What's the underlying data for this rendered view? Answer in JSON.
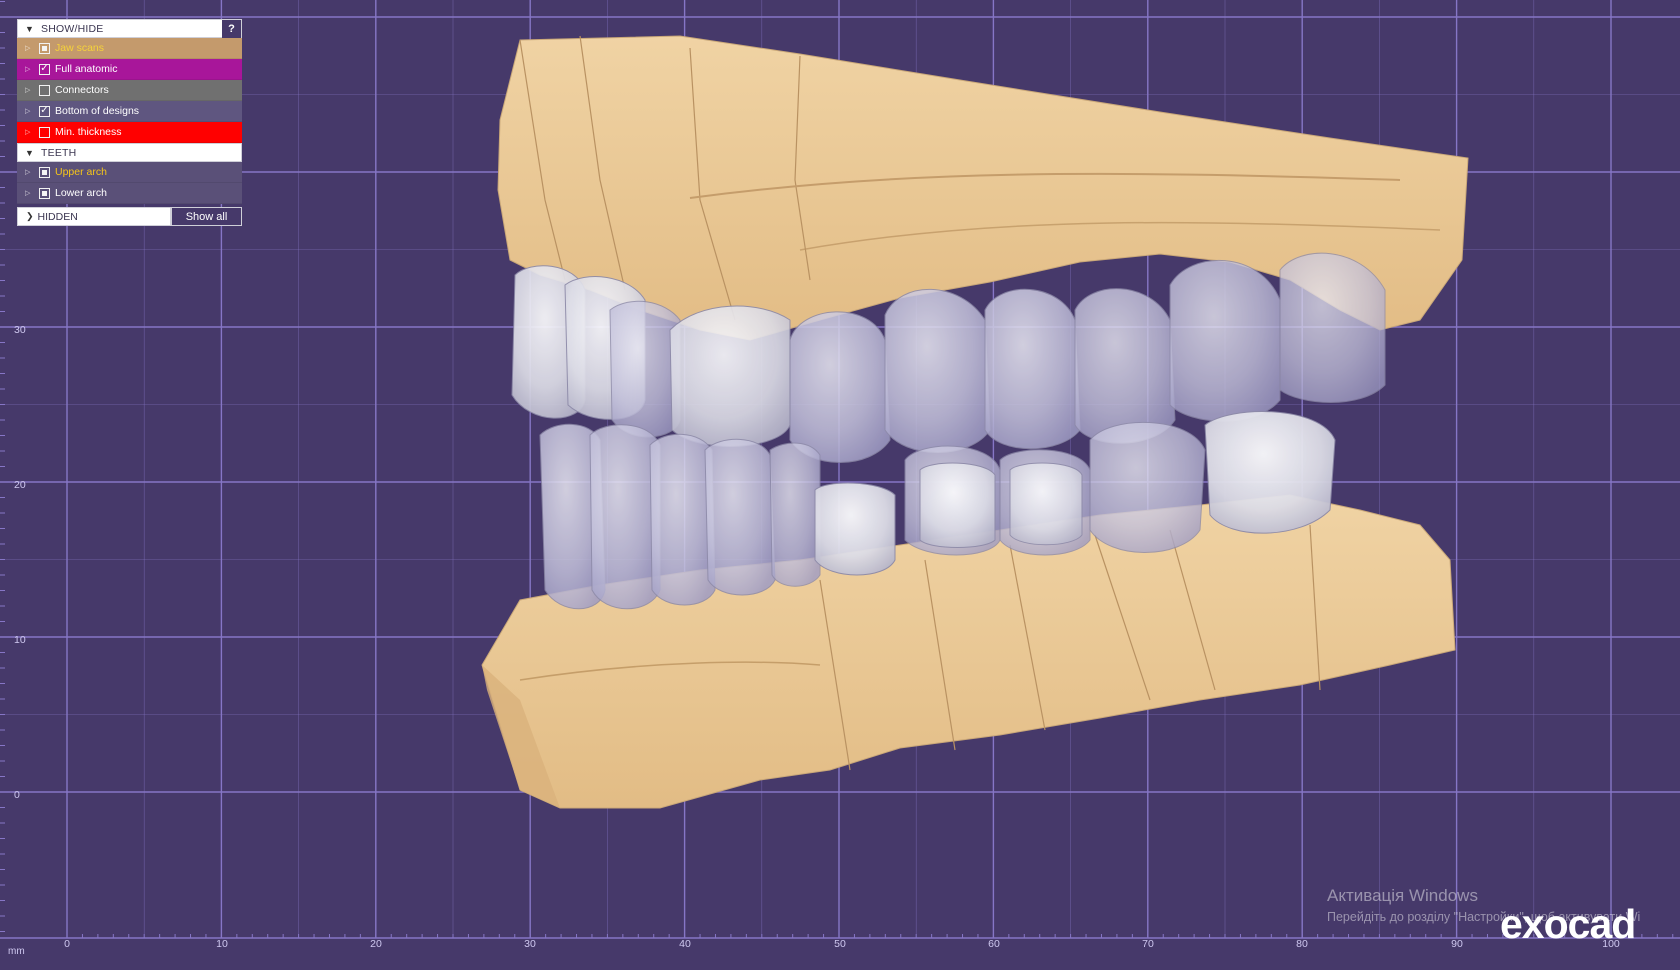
{
  "panel": {
    "show_hide": {
      "title": "SHOW/HIDE",
      "help_label": "?",
      "items": [
        {
          "label": "Jaw scans",
          "state": "partial",
          "bg": "#c49a6c",
          "text": "#f5d33a"
        },
        {
          "label": "Full anatomic",
          "state": "checked",
          "bg": "#a8169a",
          "text": "#ffffff"
        },
        {
          "label": "Connectors",
          "state": "unchecked",
          "bg": "#707070",
          "text": "#ffffff"
        },
        {
          "label": "Bottom of designs",
          "state": "checked",
          "bg": "#5f5680",
          "text": "#ffffff"
        },
        {
          "label": "Min. thickness",
          "state": "unchecked",
          "bg": "#ff0000",
          "text": "#ffffff"
        }
      ]
    },
    "teeth": {
      "title": "TEETH",
      "items": [
        {
          "label": "Upper arch",
          "state": "partial",
          "bg": "#5a5078",
          "text": "#f5c51a"
        },
        {
          "label": "Lower arch",
          "state": "partial",
          "bg": "#5a5078",
          "text": "#ffffff"
        }
      ]
    },
    "hidden": {
      "title": "HIDDEN",
      "show_all_label": "Show all"
    }
  },
  "axes": {
    "unit": "mm",
    "x_ticks": [
      "0",
      "10",
      "20",
      "30",
      "40",
      "50",
      "60",
      "70",
      "80",
      "90",
      "100"
    ],
    "y_ticks": [
      "0",
      "10",
      "20",
      "30"
    ],
    "grid_color": "#8676c6"
  },
  "watermark": {
    "line1": "Активація Windows",
    "line2": "Перейдіть до розділу \"Настройки\", щоб активувати Wi"
  },
  "brand": {
    "logo": "exocad"
  },
  "colors": {
    "background": "#46396a",
    "model": "#ecc894",
    "teeth": "#b9b6d6"
  }
}
